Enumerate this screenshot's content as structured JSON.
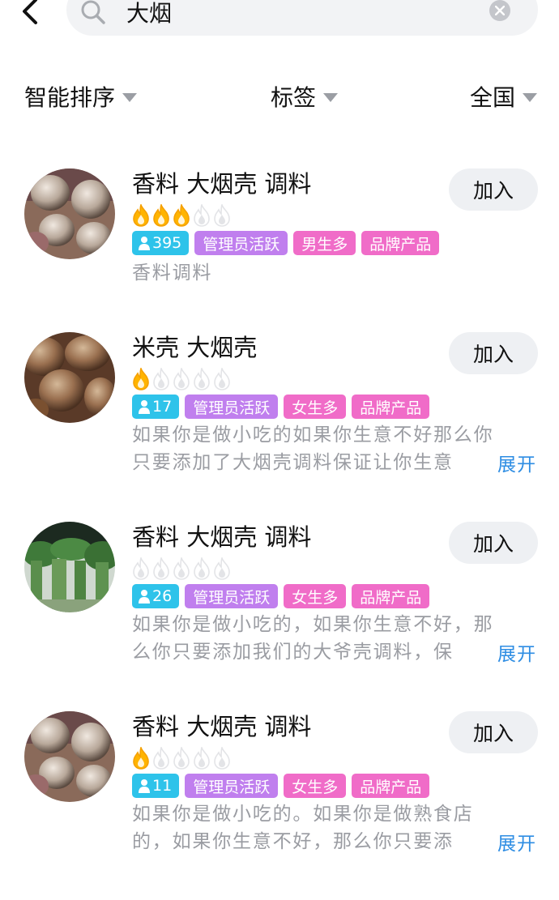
{
  "search": {
    "query": "大烟",
    "placeholder": ""
  },
  "filters": [
    {
      "label": "智能排序"
    },
    {
      "label": "标签"
    },
    {
      "label": "全国"
    }
  ],
  "colors": {
    "count_tag": "#2ec3ea",
    "admin_tag": "#c07fee",
    "pink_tag": "#f06cc8",
    "expand_link": "#2e8de3",
    "flame_active": "#ffb400",
    "flame_inactive": "#e3e4e7"
  },
  "groups": [
    {
      "title": "香料 大烟壳 调料",
      "rating": 3,
      "rating_max": 5,
      "member_count": "395",
      "tags": [
        "管理员活跃",
        "男生多",
        "品牌产品"
      ],
      "desc_lines": [
        "香料调料"
      ],
      "expand_label": "",
      "join_label": "加入",
      "avatar_icon": "spice-photo-avatar"
    },
    {
      "title": "米壳 大烟壳",
      "rating": 1,
      "rating_max": 5,
      "member_count": "17",
      "tags": [
        "管理员活跃",
        "女生多",
        "品牌产品"
      ],
      "desc_lines": [
        "如果你是做小吃的如果你生意不好那么你",
        "只要添加了大烟壳调料保证让你生意"
      ],
      "expand_label": "展开",
      "join_label": "加入",
      "avatar_icon": "poppy-pod-photo-avatar"
    },
    {
      "title": "香料 大烟壳 调料",
      "rating": 0,
      "rating_max": 5,
      "member_count": "26",
      "tags": [
        "管理员活跃",
        "女生多",
        "品牌产品"
      ],
      "desc_lines": [
        "如果你是做小吃的，如果你生意不好，那",
        "么你只要添加我们的大爷壳调料，保"
      ],
      "expand_label": "展开",
      "join_label": "加入",
      "avatar_icon": "plants-photo-avatar"
    },
    {
      "title": "香料 大烟壳 调料",
      "rating": 1,
      "rating_max": 5,
      "member_count": "11",
      "tags": [
        "管理员活跃",
        "女生多",
        "品牌产品"
      ],
      "desc_lines": [
        "如果你是做小吃的。如果你是做熟食店",
        "的，如果你生意不好，那么你只要添"
      ],
      "expand_label": "展开",
      "join_label": "加入",
      "avatar_icon": "spice-photo-avatar"
    }
  ]
}
